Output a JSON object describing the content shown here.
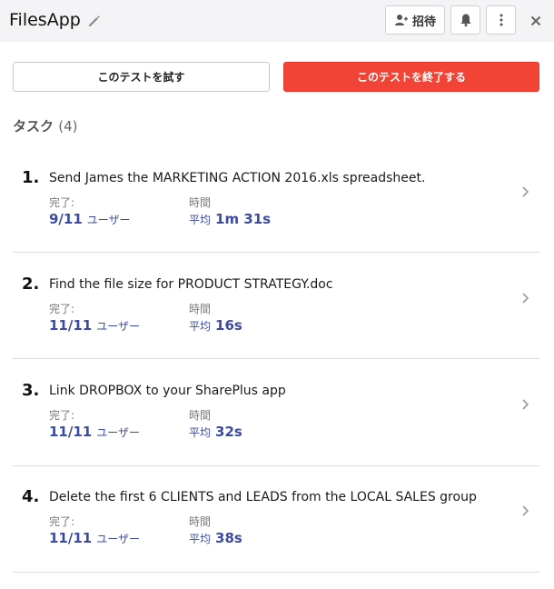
{
  "header": {
    "app_title": "FilesApp",
    "invite_label": "招待",
    "icons": [
      "pencil-icon",
      "add-user-icon",
      "bell-icon",
      "more-vertical-icon",
      "close-icon"
    ]
  },
  "actions": {
    "try_label": "このテストを試す",
    "end_label": "このテストを終了する",
    "end_color": "#f14336"
  },
  "tasks_section": {
    "title": "タスク",
    "count": "(4)"
  },
  "labels": {
    "completed": "完了:",
    "time": "時間",
    "users_unit": "ユーザー",
    "avg_prefix": "平均"
  },
  "tasks": [
    {
      "number": "1.",
      "title": "Send James the MARKETING ACTION 2016.xls spreadsheet.",
      "completed": "9/11",
      "avg_time": "1m 31s"
    },
    {
      "number": "2.",
      "title": "Find the file size for PRODUCT STRATEGY.doc",
      "completed": "11/11",
      "avg_time": "16s"
    },
    {
      "number": "3.",
      "title": "Link DROPBOX to your SharePlus app",
      "completed": "11/11",
      "avg_time": "32s"
    },
    {
      "number": "4.",
      "title": "Delete the first 6 CLIENTS and LEADS from the LOCAL SALES group",
      "completed": "11/11",
      "avg_time": "38s"
    }
  ],
  "colors": {
    "accent": "#3b4ba3",
    "header_bg": "#f4f4f6"
  }
}
